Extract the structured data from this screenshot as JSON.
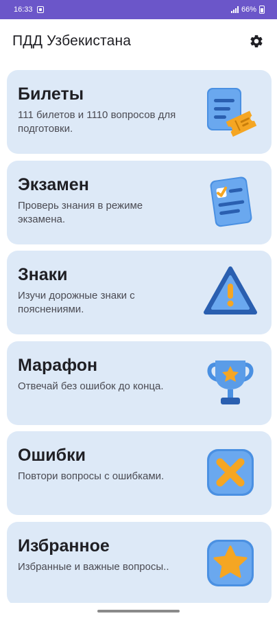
{
  "status_bar": {
    "time": "16:33",
    "battery": "66%",
    "notification_icon": "square-notification-icon",
    "signal_icon": "signal-icon",
    "battery_icon": "battery-icon"
  },
  "app_bar": {
    "title": "ПДД Узбекистана",
    "settings_icon": "gear-icon"
  },
  "cards": [
    {
      "title": "Билеты",
      "description": "111 билетов и 1110 вопросов для подготовки.",
      "icon": "ticket-icon"
    },
    {
      "title": "Экзамен",
      "description": "Проверь знания в режиме экзамена.",
      "icon": "checklist-icon"
    },
    {
      "title": "Знаки",
      "description": "Изучи дорожные знаки с пояснениями.",
      "icon": "warning-sign-icon"
    },
    {
      "title": "Марафон",
      "description": "Отвечай без ошибок до конца.",
      "icon": "trophy-icon"
    },
    {
      "title": "Ошибки",
      "description": "Повтори вопросы с ошибками.",
      "icon": "cross-icon"
    },
    {
      "title": "Избранное",
      "description": "Избранные и важные вопросы..",
      "icon": "star-icon"
    }
  ],
  "colors": {
    "status_bar": "#6b56c9",
    "card_background": "#dde9f7",
    "icon_blue": "#4a90e2",
    "icon_orange": "#f5a623"
  }
}
